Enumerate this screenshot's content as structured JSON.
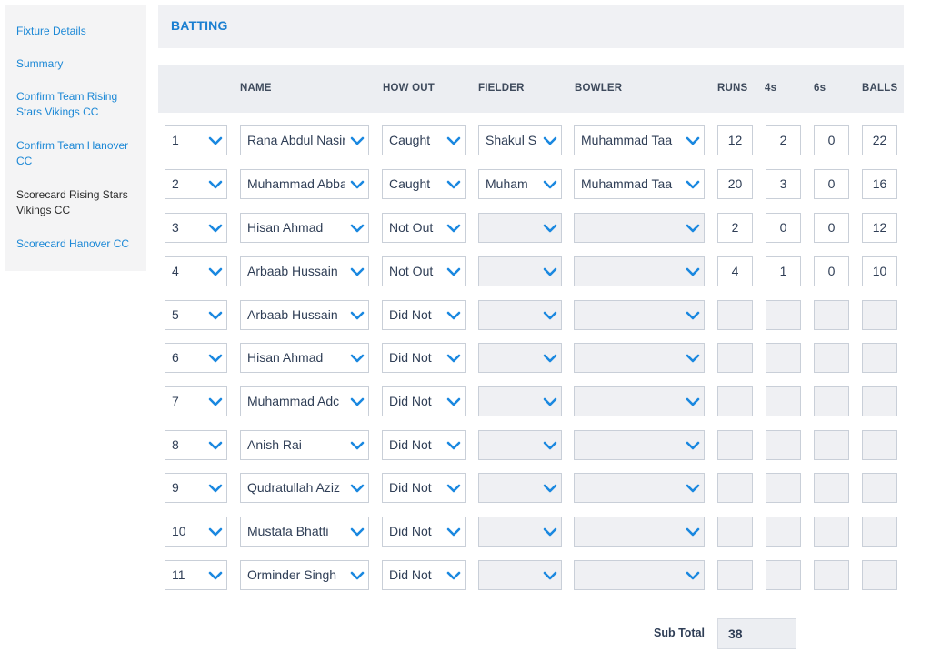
{
  "sidebar": {
    "items": [
      {
        "label": "Fixture Details",
        "active": false
      },
      {
        "label": "Summary",
        "active": false
      },
      {
        "label": "Confirm Team Rising Stars Vikings CC",
        "active": false
      },
      {
        "label": "Confirm Team Hanover CC",
        "active": false
      },
      {
        "label": "Scorecard Rising Stars Vikings CC",
        "active": true
      },
      {
        "label": "Scorecard Hanover CC",
        "active": false
      }
    ]
  },
  "batting": {
    "title": "BATTING",
    "columns": {
      "name": "NAME",
      "how_out": "HOW OUT",
      "fielder": "FIELDER",
      "bowler": "BOWLER",
      "runs": "RUNS",
      "fours": "4s",
      "sixes": "6s",
      "balls": "BALLS"
    },
    "rows": [
      {
        "pos": "1",
        "name": "Rana Abdul Nasir",
        "how_out": "Caught",
        "fielder": "Shakul S",
        "bowler": "Muhammad Taa",
        "runs": "12",
        "fours": "2",
        "sixes": "0",
        "balls": "22"
      },
      {
        "pos": "2",
        "name": "Muhammad Abbas",
        "how_out": "Caught",
        "fielder": "Muham",
        "bowler": "Muhammad Taa",
        "runs": "20",
        "fours": "3",
        "sixes": "0",
        "balls": "16"
      },
      {
        "pos": "3",
        "name": "Hisan Ahmad",
        "how_out": "Not Out",
        "fielder": "",
        "bowler": "",
        "runs": "2",
        "fours": "0",
        "sixes": "0",
        "balls": "12"
      },
      {
        "pos": "4",
        "name": "Arbaab Hussain",
        "how_out": "Not Out",
        "fielder": "",
        "bowler": "",
        "runs": "4",
        "fours": "1",
        "sixes": "0",
        "balls": "10"
      },
      {
        "pos": "5",
        "name": "Arbaab Hussain",
        "how_out": "Did Not",
        "fielder": "",
        "bowler": "",
        "runs": "",
        "fours": "",
        "sixes": "",
        "balls": ""
      },
      {
        "pos": "6",
        "name": "Hisan Ahmad",
        "how_out": "Did Not",
        "fielder": "",
        "bowler": "",
        "runs": "",
        "fours": "",
        "sixes": "",
        "balls": ""
      },
      {
        "pos": "7",
        "name": "Muhammad Adc",
        "how_out": "Did Not",
        "fielder": "",
        "bowler": "",
        "runs": "",
        "fours": "",
        "sixes": "",
        "balls": ""
      },
      {
        "pos": "8",
        "name": "Anish Rai",
        "how_out": "Did Not",
        "fielder": "",
        "bowler": "",
        "runs": "",
        "fours": "",
        "sixes": "",
        "balls": ""
      },
      {
        "pos": "9",
        "name": "Qudratullah Aziz",
        "how_out": "Did Not",
        "fielder": "",
        "bowler": "",
        "runs": "",
        "fours": "",
        "sixes": "",
        "balls": ""
      },
      {
        "pos": "10",
        "name": "Mustafa Bhatti",
        "how_out": "Did Not",
        "fielder": "",
        "bowler": "",
        "runs": "",
        "fours": "",
        "sixes": "",
        "balls": ""
      },
      {
        "pos": "11",
        "name": "Orminder Singh",
        "how_out": "Did Not",
        "fielder": "",
        "bowler": "",
        "runs": "",
        "fours": "",
        "sixes": "",
        "balls": ""
      }
    ],
    "subtotal_label": "Sub Total",
    "subtotal_value": "38"
  },
  "icons": {
    "dropdown": "chevron-down-icon"
  },
  "colors": {
    "accent": "#1a88e0",
    "link": "#1c88d6",
    "header_bg": "#eceef2"
  }
}
